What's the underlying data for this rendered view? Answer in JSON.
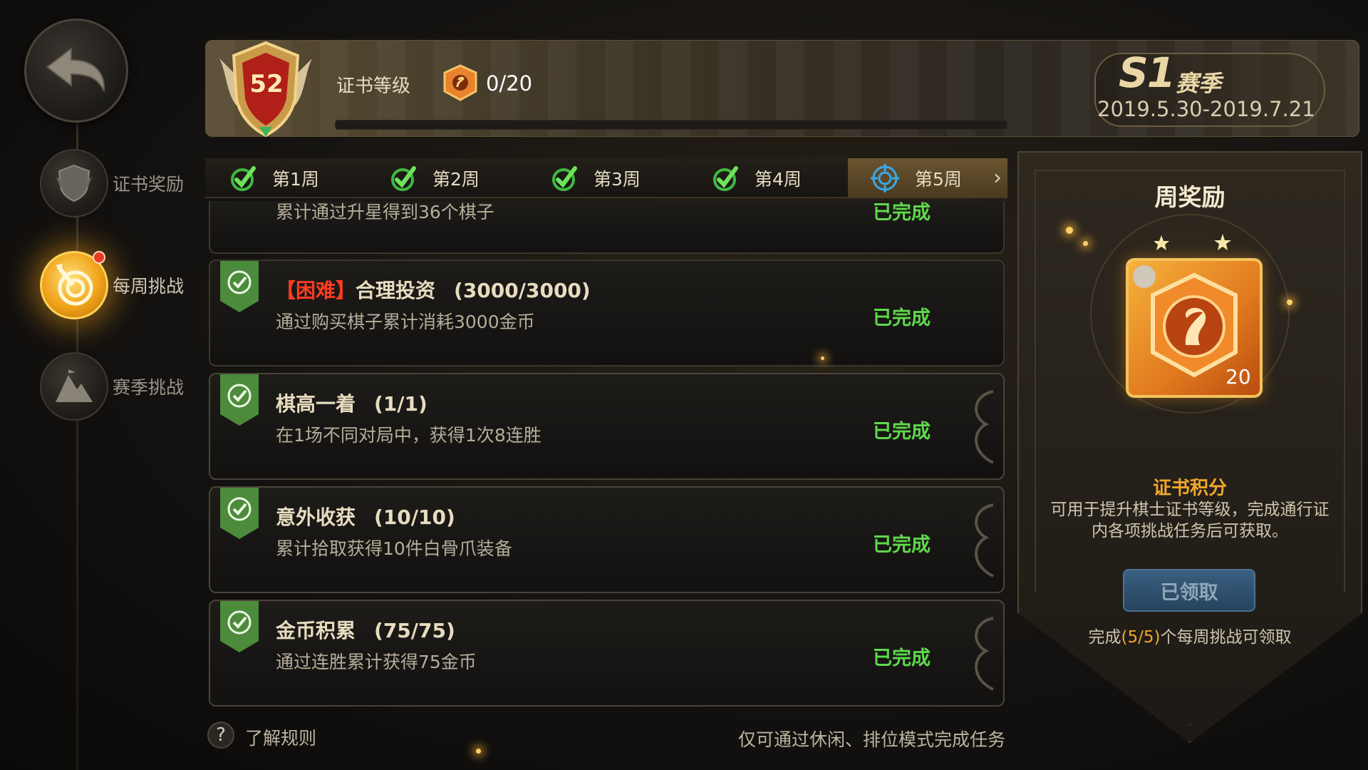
{
  "header": {
    "level": "52",
    "cert_label": "证书等级",
    "points": "0/20",
    "progress": 0,
    "season": {
      "code": "S1",
      "word": "赛季",
      "dates": "2019.5.30-2019.7.21"
    }
  },
  "sidebar": {
    "items": [
      {
        "label": "证书奖励",
        "icon": "shield-icon"
      },
      {
        "label": "每周挑战",
        "icon": "target-icon",
        "active": true
      },
      {
        "label": "赛季挑战",
        "icon": "mountain-icon"
      }
    ]
  },
  "tabs": [
    {
      "label": "第1周",
      "done": true
    },
    {
      "label": "第2周",
      "done": true
    },
    {
      "label": "第3周",
      "done": true
    },
    {
      "label": "第4周",
      "done": true
    },
    {
      "label": "第5周",
      "done": false,
      "active": true
    }
  ],
  "tasks": [
    {
      "tag": "",
      "title": "",
      "progress": "",
      "desc": "累计通过升星得到36个棋子",
      "status": "已完成",
      "partial": true
    },
    {
      "tag": "【困难】",
      "title": "合理投资",
      "progress": "(3000/3000)",
      "desc": "通过购买棋子累计消耗3000金币",
      "status": "已完成"
    },
    {
      "tag": "",
      "title": "棋高一着",
      "progress": "(1/1)",
      "desc": "在1场不同对局中，获得1次8连胜",
      "status": "已完成"
    },
    {
      "tag": "",
      "title": "意外收获",
      "progress": "(10/10)",
      "desc": "累计拾取获得10件白骨爪装备",
      "status": "已完成"
    },
    {
      "tag": "",
      "title": "金币积累",
      "progress": "(75/75)",
      "desc": "通过连胜累计获得75金币",
      "status": "已完成"
    }
  ],
  "reward_panel": {
    "title": "周奖励",
    "count": "20",
    "name": "证书积分",
    "desc": "可用于提升棋士证书等级，完成通行证内各项挑战任务后可获取。",
    "button": "已领取",
    "note_prefix": "完成",
    "note_count": "(5/5)",
    "note_suffix": "个每周挑战可领取"
  },
  "footer": {
    "help_icon": "?",
    "help_label": "了解规则",
    "note": "仅可通过休闲、排位模式完成任务"
  },
  "colors": {
    "complete": "#5fd84c",
    "hard": "#ff3b22",
    "accent": "#f0a62a"
  }
}
